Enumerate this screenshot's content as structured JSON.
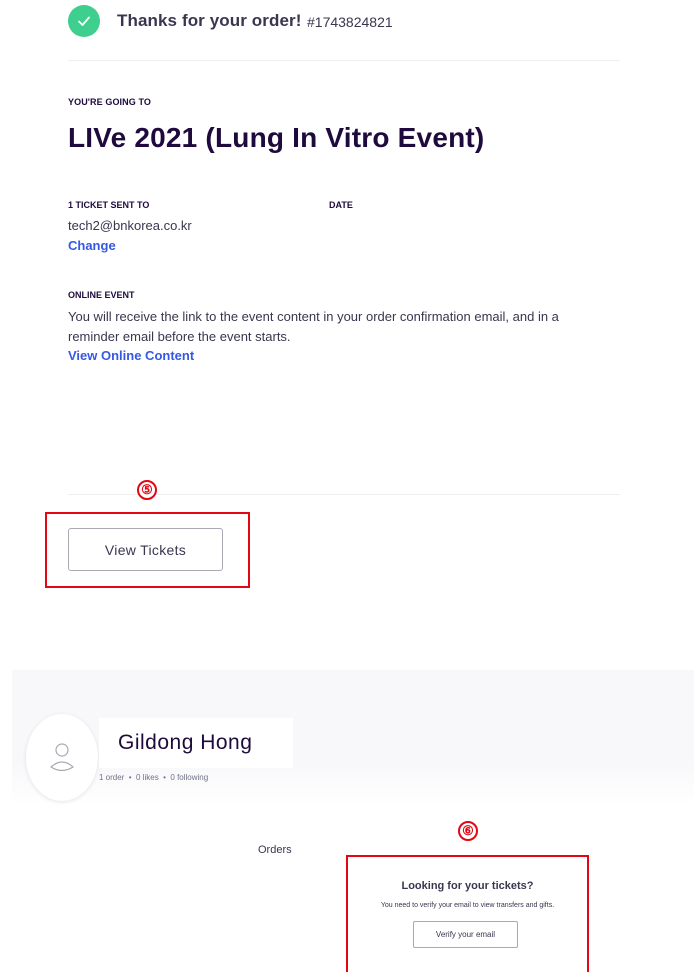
{
  "confirmation": {
    "thanks_text": "Thanks for your order!",
    "order_number": "#1743824821"
  },
  "event": {
    "going_label": "YOU'RE GOING TO",
    "title": "LIVe 2021 (Lung In Vitro Event)"
  },
  "ticket_info": {
    "sent_label": "1 TICKET SENT TO",
    "date_label": "DATE",
    "email": "tech2@bnkorea.co.kr",
    "change_link": "Change"
  },
  "online_event": {
    "label": "ONLINE EVENT",
    "description": "You will receive the link to the event content in your order confirmation email, and in a reminder email before the event starts.",
    "link": "View Online Content"
  },
  "actions": {
    "view_tickets": "View Tickets"
  },
  "steps": {
    "step5": "⑤",
    "step6": "⑥"
  },
  "profile": {
    "name": "Gildong Hong",
    "stats": "1 order  •  0 likes  •  0 following",
    "orders_label": "Orders"
  },
  "tickets_panel": {
    "heading": "Looking for your tickets?",
    "description": "You need to verify your email to view transfers and gifts.",
    "verify_button": "Verify your email"
  },
  "colors": {
    "success": "#3ecf8e",
    "link": "#3659e3",
    "highlight": "#e30613",
    "heading": "#1e0a3c"
  },
  "icons": [
    "check-icon",
    "user-icon"
  ]
}
